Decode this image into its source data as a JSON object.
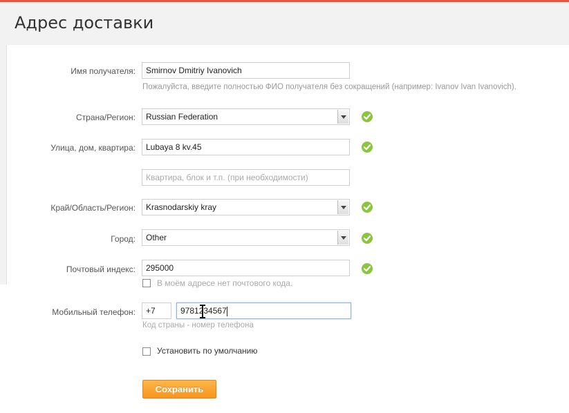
{
  "page": {
    "title": "Адрес доставки"
  },
  "form": {
    "recipient": {
      "label": "Имя получателя:",
      "value": "Smirnov Dmitriy Ivanovich",
      "hint": "Пожалуйста, введите полностью ФИО получателя без сокращений (например: Ivanov Ivan Ivanovich)."
    },
    "country": {
      "label": "Страна/Регион:",
      "value": "Russian Federation",
      "valid": true
    },
    "street": {
      "label": "Улица, дом, квартира:",
      "value": "Lubaya 8 kv.45",
      "valid": true
    },
    "apartment": {
      "placeholder": "Квартира, блок и т.п. (при необходимости)"
    },
    "region": {
      "label": "Край/Область/Регион:",
      "value": "Krasnodarskiy kray",
      "valid": true
    },
    "city": {
      "label": "Город:",
      "value": "Other",
      "valid": true
    },
    "postal": {
      "label": "Почтовый индекс:",
      "value": "295000",
      "valid": true,
      "no_postal_label": "В моём адресе нет почтового кода.",
      "no_postal_checked": false
    },
    "phone": {
      "label": "Мобильный телефон:",
      "country_code": "+7",
      "number": "9781234567",
      "hint": "Код страны - номер телефона"
    },
    "default": {
      "label": "Установить по умолчанию",
      "checked": false
    },
    "save_label": "Сохранить"
  },
  "colors": {
    "accent_top": "#e8563f",
    "valid_check": "#8cc63f",
    "save_button": "#f7961e",
    "focus_border": "#8fb3d9"
  },
  "icons": {
    "valid": "check-circle-icon",
    "select": "chevron-down-icon",
    "cursor": "text-cursor-icon"
  }
}
